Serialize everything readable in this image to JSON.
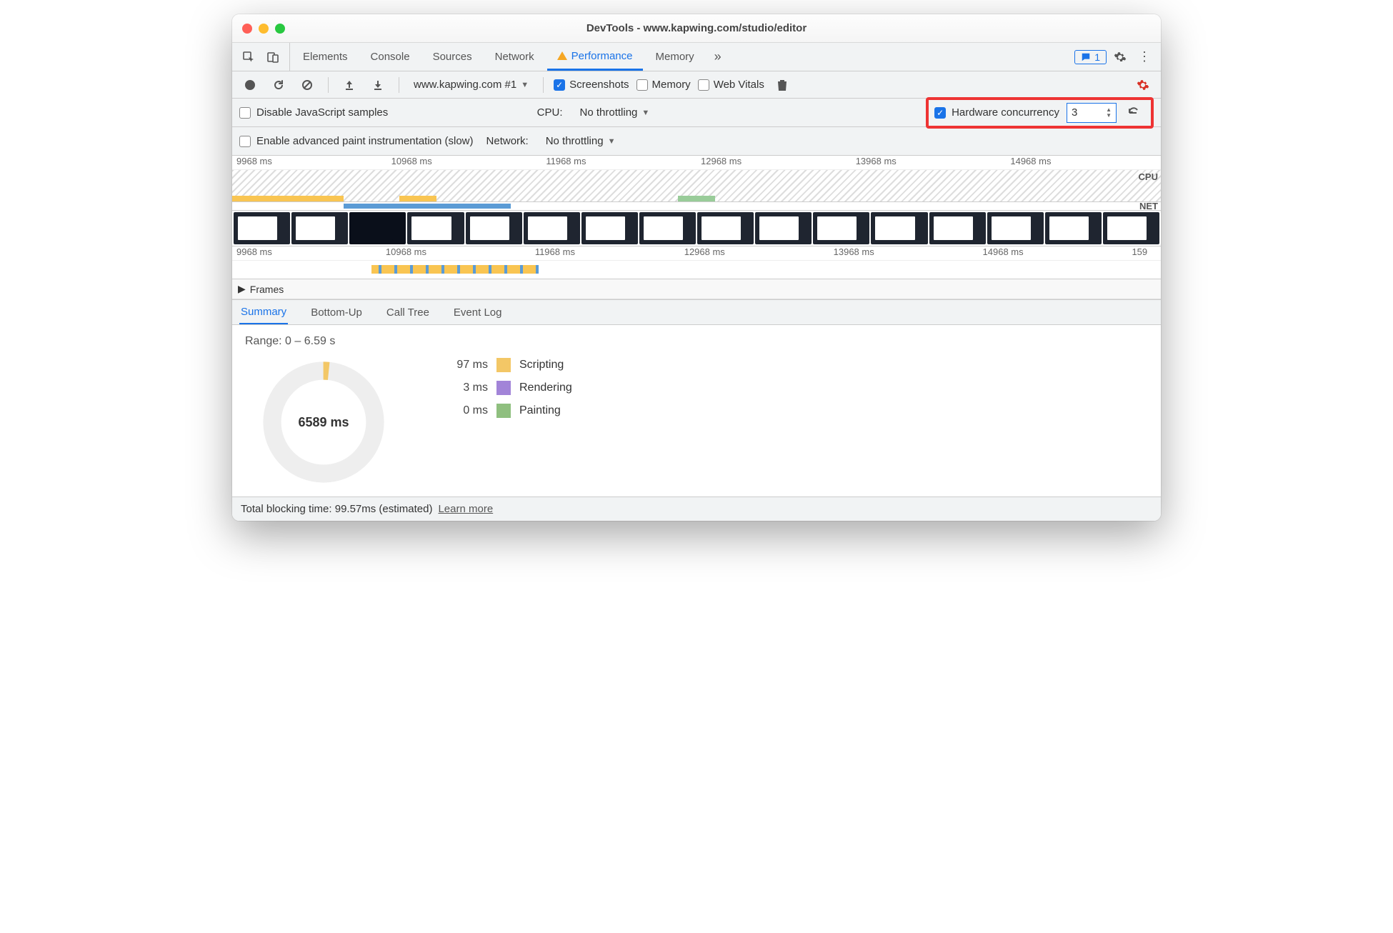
{
  "window": {
    "title": "DevTools - www.kapwing.com/studio/editor"
  },
  "tabs": {
    "items": [
      "Elements",
      "Console",
      "Sources",
      "Network",
      "Performance",
      "Memory"
    ],
    "active": "Performance",
    "messages_count": "1"
  },
  "toolbar": {
    "page_selector": "www.kapwing.com #1",
    "screenshots_label": "Screenshots",
    "memory_label": "Memory",
    "webvitals_label": "Web Vitals"
  },
  "options_row1": {
    "disable_js": "Disable JavaScript samples",
    "cpu_label": "CPU:",
    "cpu_value": "No throttling",
    "hw_label": "Hardware concurrency",
    "hw_value": "3"
  },
  "options_row2": {
    "paint_instr": "Enable advanced paint instrumentation (slow)",
    "network_label": "Network:",
    "network_value": "No throttling"
  },
  "ruler": [
    "9968 ms",
    "10968 ms",
    "11968 ms",
    "12968 ms",
    "13968 ms",
    "14968 ms"
  ],
  "ruler2": [
    "9968 ms",
    "10968 ms",
    "11968 ms",
    "12968 ms",
    "13968 ms",
    "14968 ms",
    "159"
  ],
  "side": {
    "cpu": "CPU",
    "net": "NET"
  },
  "sections": {
    "frames": "Frames"
  },
  "bottom_tabs": {
    "items": [
      "Summary",
      "Bottom-Up",
      "Call Tree",
      "Event Log"
    ],
    "active": "Summary"
  },
  "summary": {
    "range": "Range: 0 – 6.59 s",
    "center": "6589 ms",
    "legend": [
      {
        "ms": "97 ms",
        "label": "Scripting",
        "cls": "script"
      },
      {
        "ms": "3 ms",
        "label": "Rendering",
        "cls": "render"
      },
      {
        "ms": "0 ms",
        "label": "Painting",
        "cls": "paint"
      }
    ]
  },
  "footer": {
    "tbt": "Total blocking time: 99.57ms (estimated)",
    "learn": "Learn more"
  }
}
